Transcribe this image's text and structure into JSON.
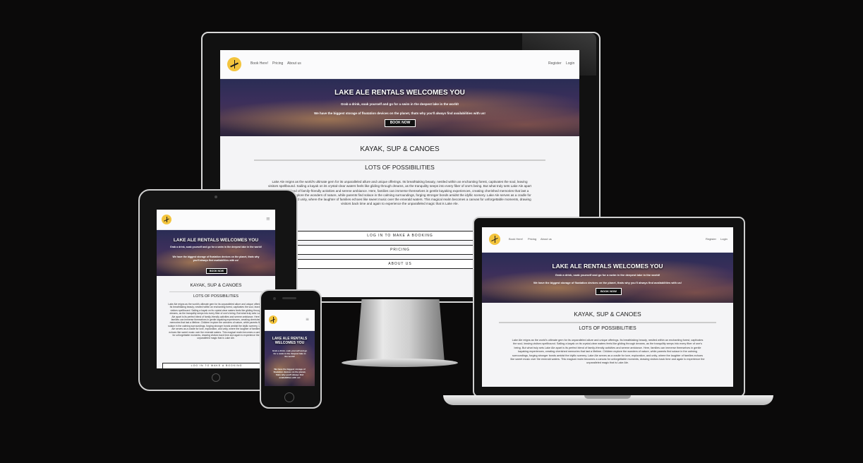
{
  "site": {
    "nav_links": [
      "Book Here!",
      "Pricing",
      "About us"
    ],
    "nav_right": [
      "Register",
      "Login"
    ],
    "hero_title": "LAKE ALE RENTALS WELCOMES YOU",
    "hero_line1": "Grab a drink, soak yourself and go for a swim in the deepest lake in the world!",
    "hero_line2": "We have the biggest storage of floatation devices on the planet, thats why you'll always find availabilities with us!",
    "hero_button": "BOOK NOW",
    "section_title": "KAYAK, SUP & CANOES",
    "section_subtitle": "LOTS OF POSSIBILITIES",
    "paragraph": "Lake Ale reigns as the world's ultimate gem for its unparalleled allure and unique offerings. Its breathtaking beauty, nestled within an enchanting forest, captivates the soul, leaving visitors spellbound. Sailing a kayak on its crystal-clear waters feels like gliding through dreams, as the tranquility seeps into every fiber of one's being. But what truly sets Lake Ale apart is its perfect blend of family-friendly activities and serene ambiance. Here, families can immerse themselves in gentle kayaking experiences, creating cherished memories that last a lifetime. Children explore the wonders of nature, while parents find solace in the calming surroundings, forging stronger bonds amidst the idyllic scenery. Lake Ale serves as a cradle for love, exploration, and unity, where the laughter of families echoes like sweet music over the emerald waters. This magical realm becomes a canvas for unforgettable moments, drawing visitors back time and again to experience the unparalleled magic that is Lake Ale.",
    "buttons": [
      "LOG IN TO MAKE A BOOKING",
      "PRICING",
      "ABOUT US"
    ],
    "menu_icon": "hamburger-icon"
  },
  "colors": {
    "background": "#0b0a0a",
    "logo": "#f3c43d",
    "hero_dark": "#2a2d55"
  }
}
